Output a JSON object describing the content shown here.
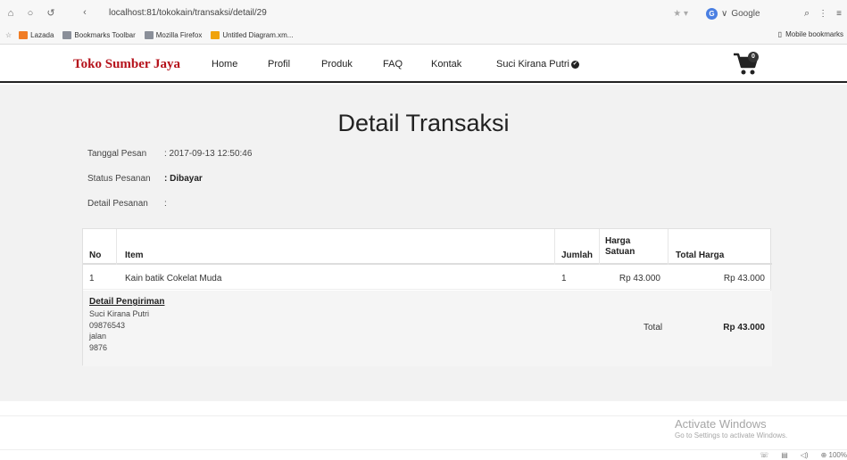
{
  "browser": {
    "url": "localhost:81/tokokain/transaksi/detail/29",
    "search_engine": "Google",
    "bookmarks": [
      "Lazada",
      "Bookmarks Toolbar",
      "Mozilla Firefox",
      "Untitled Diagram.xm..."
    ],
    "mobile_bookmarks": "Mobile bookmarks",
    "zoom": "100%"
  },
  "site": {
    "brand": "Toko Sumber Jaya",
    "menu": [
      "Home",
      "Profil",
      "Produk",
      "FAQ",
      "Kontak"
    ],
    "user": "Suci Kirana Putri",
    "cart_count": "0"
  },
  "page": {
    "title": "Detail Transaksi",
    "tanggal_label": "Tanggal Pesan",
    "tanggal_value": ": 2017-09-13 12:50:46",
    "status_label": "Status Pesanan",
    "status_value": ": Dibayar",
    "detail_label": "Detail Pesanan",
    "detail_value": ":"
  },
  "table": {
    "headers": {
      "no": "No",
      "item": "Item",
      "jumlah": "Jumlah",
      "harga_1": "Harga",
      "harga_2": "Satuan",
      "total": "Total Harga"
    },
    "rows": [
      {
        "no": "1",
        "item": "Kain batik Cokelat Muda",
        "jumlah": "1",
        "harga": "Rp 43.000",
        "total": "Rp 43.000"
      }
    ],
    "shipping": {
      "title": "Detail Pengiriman",
      "name": "Suci Kirana Putri",
      "phone": "09876543",
      "address": "jalan",
      "postal": "9876"
    },
    "total_label": "Total",
    "total_value": "Rp 43.000"
  },
  "activate": {
    "line1": "Activate Windows",
    "line2": "Go to Settings to activate Windows."
  }
}
